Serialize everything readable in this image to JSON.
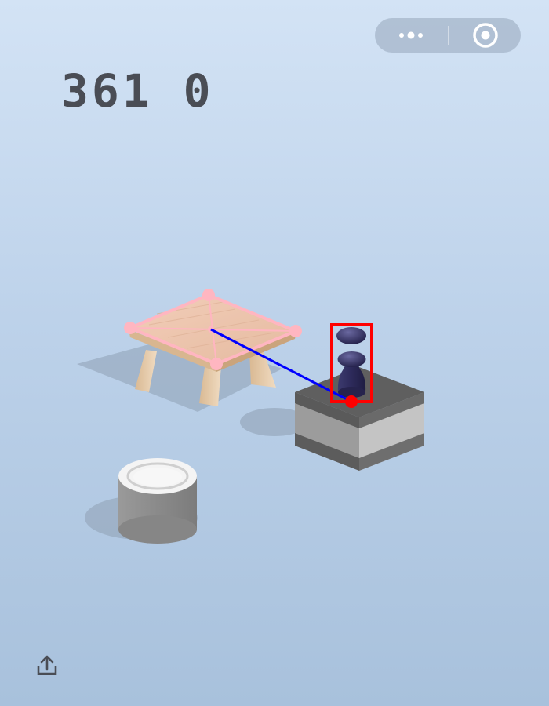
{
  "score": "361 0",
  "capsule": {
    "more_icon": "more-dots-icon",
    "close_icon": "target-circle-icon"
  },
  "share_icon": "share-upload-icon",
  "colors": {
    "background_top": "#d3e3f5",
    "background_bottom": "#a8c1dc",
    "score_text": "#4a4d55",
    "player_piece": "#2f2c5a",
    "table_wood": "#e8c9a6",
    "overlay_pink": "#ffb6c1",
    "overlay_line": "#0000ff",
    "overlay_box": "#ff0000"
  }
}
